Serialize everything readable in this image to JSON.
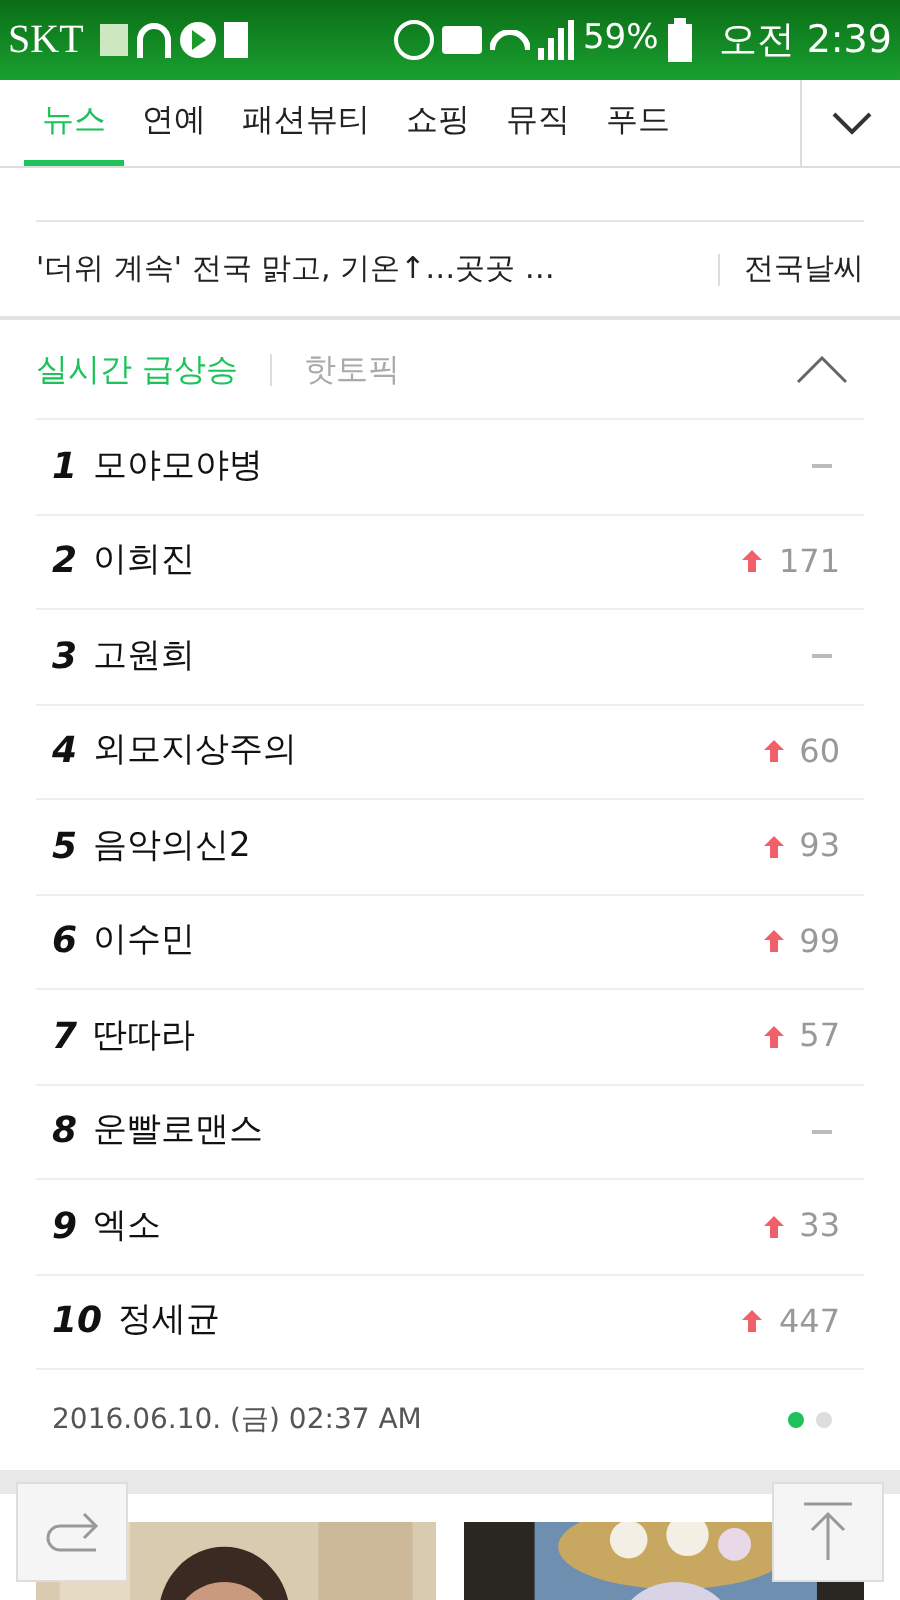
{
  "status_bar": {
    "carrier": "SKT",
    "battery": "59%",
    "time": "오전 2:39"
  },
  "tabs": [
    {
      "label": "뉴스",
      "selected": true
    },
    {
      "label": "연예",
      "selected": false
    },
    {
      "label": "패션뷰티",
      "selected": false
    },
    {
      "label": "쇼핑",
      "selected": false
    },
    {
      "label": "뮤직",
      "selected": false
    },
    {
      "label": "푸드",
      "selected": false
    }
  ],
  "weather": {
    "headline": "'더위 계속' 전국 맑고, 기온↑…곳곳 …",
    "link": "전국날씨"
  },
  "ranking_tabs": [
    {
      "label": "실시간 급상승",
      "selected": true
    },
    {
      "label": "핫토픽",
      "selected": false
    }
  ],
  "ranking": [
    {
      "rank": "1",
      "keyword": "모야모야병",
      "kind": "same"
    },
    {
      "rank": "2",
      "keyword": "이희진",
      "kind": "up",
      "change": "171"
    },
    {
      "rank": "3",
      "keyword": "고원희",
      "kind": "same"
    },
    {
      "rank": "4",
      "keyword": "외모지상주의",
      "kind": "up",
      "change": "60"
    },
    {
      "rank": "5",
      "keyword": "음악의신2",
      "kind": "up",
      "change": "93"
    },
    {
      "rank": "6",
      "keyword": "이수민",
      "kind": "up",
      "change": "99"
    },
    {
      "rank": "7",
      "keyword": "딴따라",
      "kind": "up",
      "change": "57"
    },
    {
      "rank": "8",
      "keyword": "운빨로맨스",
      "kind": "same"
    },
    {
      "rank": "9",
      "keyword": "엑소",
      "kind": "up",
      "change": "33"
    },
    {
      "rank": "10",
      "keyword": "정세균",
      "kind": "up",
      "change": "447"
    }
  ],
  "timestamp": "2016.06.10. (금) 02:37 AM",
  "pages": [
    {
      "selected": true
    },
    {
      "selected": false
    }
  ]
}
